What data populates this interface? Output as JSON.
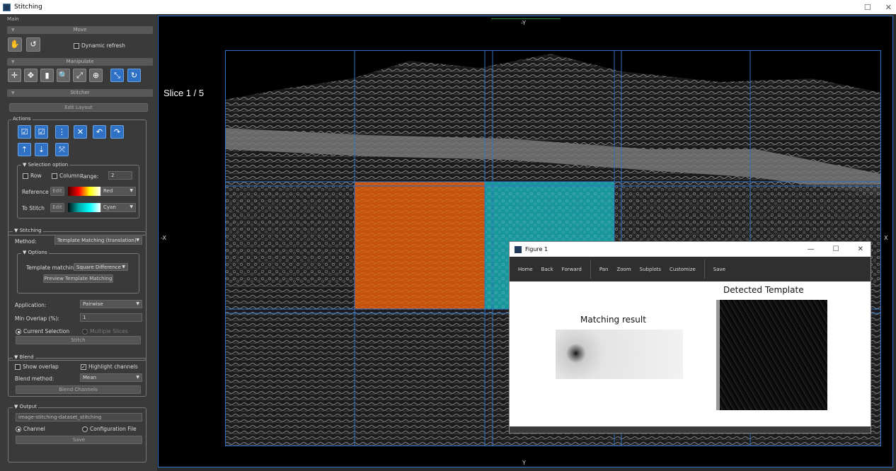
{
  "window": {
    "title": "Stitching",
    "min": "—",
    "max": "☐",
    "close": "✕"
  },
  "panel": {
    "main_label": "Main",
    "move": {
      "title": "Move",
      "dynamic_refresh": "Dynamic refresh",
      "dynamic_refresh_checked": false
    },
    "manipulate": {
      "title": "Manipulate"
    },
    "stitcher": {
      "title": "Stitcher",
      "edit_layout": "Edit Layout",
      "actions_label": "Actions",
      "selection_option": {
        "title": "Selection option",
        "row": "Row",
        "column": "Column",
        "range_label": "Range:",
        "range_value": "2",
        "reference_label": "Reference",
        "to_stitch_label": "To Stitch",
        "edit": "Edit",
        "reference_color": "Red",
        "to_stitch_color": "Cyan"
      },
      "stitching": {
        "title": "Stitching",
        "method_label": "Method:",
        "method_value": "Template Matching (translation)",
        "options_title": "Options",
        "template_matching_label": "Template matching",
        "template_matching_value": "Square Difference",
        "preview_button": "Preview Template Matching",
        "application_label": "Application:",
        "application_value": "Pairwise",
        "min_overlap_label": "Min Overlap (%):",
        "min_overlap_value": "1",
        "current_selection": "Current Selection",
        "multiple_slices": "Multiple Slices",
        "stitch_button": "Stitch"
      },
      "blend": {
        "title": "Blend",
        "show_overlap": "Show overlap",
        "highlight_channels": "Highlight channels",
        "method_label": "Blend method:",
        "method_value": "Mean",
        "blend_button": "Blend Channels"
      },
      "output": {
        "title": "Output",
        "name_value": "image-stitching-dataset_stitching",
        "channel": "Channel",
        "config_file": "Configuration File",
        "save_button": "Save"
      }
    }
  },
  "viewer": {
    "slice_label": "Slice 1 / 5",
    "axis_top": "-Y",
    "axis_bottom": "Y",
    "axis_left": "-X",
    "axis_right": "X",
    "accent": "#2f72c5"
  },
  "figure": {
    "title": "Figure 1",
    "toolbar": [
      "Home",
      "Back",
      "Forward",
      "Pan",
      "Zoom",
      "Subplots",
      "Customize",
      "Save"
    ],
    "left_plot_title": "Matching result",
    "right_plot_title": "Detected Template"
  }
}
